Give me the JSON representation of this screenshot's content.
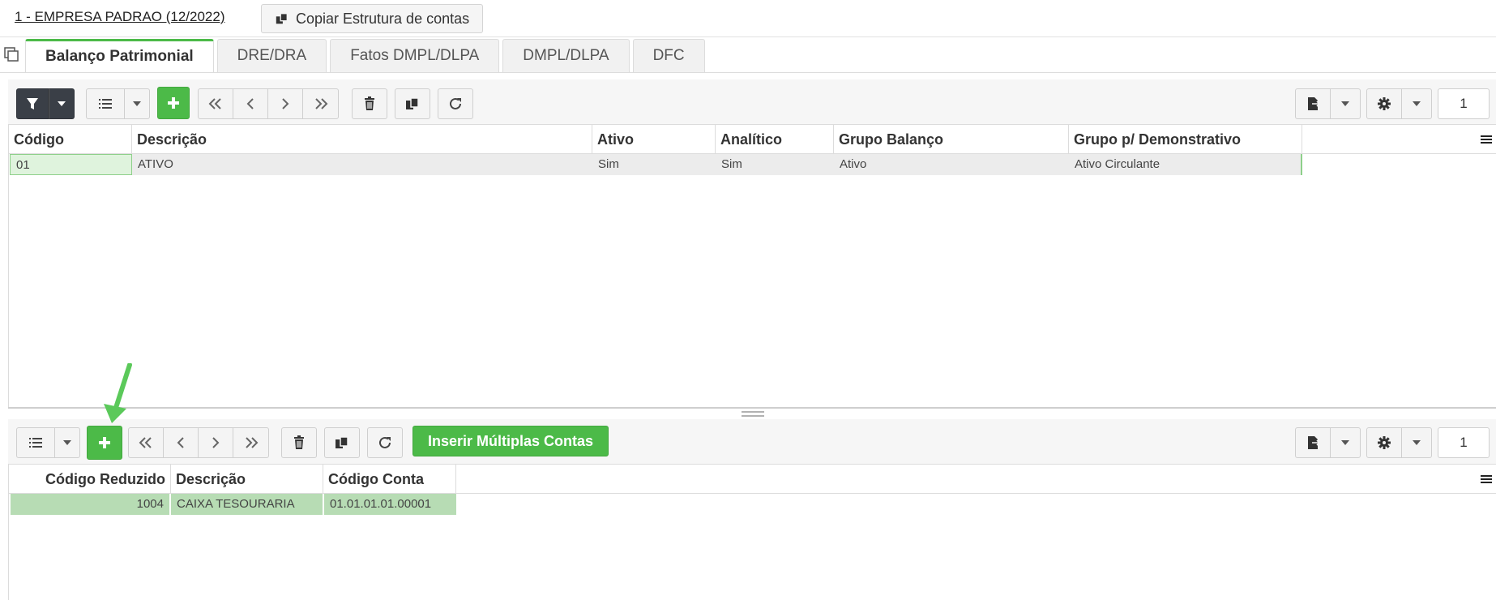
{
  "header": {
    "company": "1 - EMPRESA PADRAO (12/2022)",
    "copy_button": "Copiar Estrutura de contas"
  },
  "tabs": [
    {
      "label": "Balanço Patrimonial",
      "active": true
    },
    {
      "label": "DRE/DRA"
    },
    {
      "label": "Fatos DMPL/DLPA"
    },
    {
      "label": "DMPL/DLPA"
    },
    {
      "label": "DFC"
    }
  ],
  "top_toolbar": {
    "page": "1"
  },
  "top_grid": {
    "columns": [
      "Código",
      "Descrição",
      "Ativo",
      "Analítico",
      "Grupo Balanço",
      "Grupo p/ Demonstrativo"
    ],
    "rows": [
      [
        "01",
        "ATIVO",
        "Sim",
        "Sim",
        "Ativo",
        "Ativo Circulante"
      ]
    ]
  },
  "bottom_toolbar": {
    "insert_multiple": "Inserir Múltiplas Contas",
    "page": "1"
  },
  "bottom_grid": {
    "columns": [
      "Código Reduzido",
      "Descrição",
      "Código Conta"
    ],
    "rows": [
      [
        "1004",
        "CAIXA TESOURARIA",
        "01.01.01.01.00001"
      ]
    ]
  },
  "colors": {
    "accent_green": "#4cba48",
    "filter_dark": "#3a3f47",
    "annotation_arrow": "#5bc95a"
  }
}
